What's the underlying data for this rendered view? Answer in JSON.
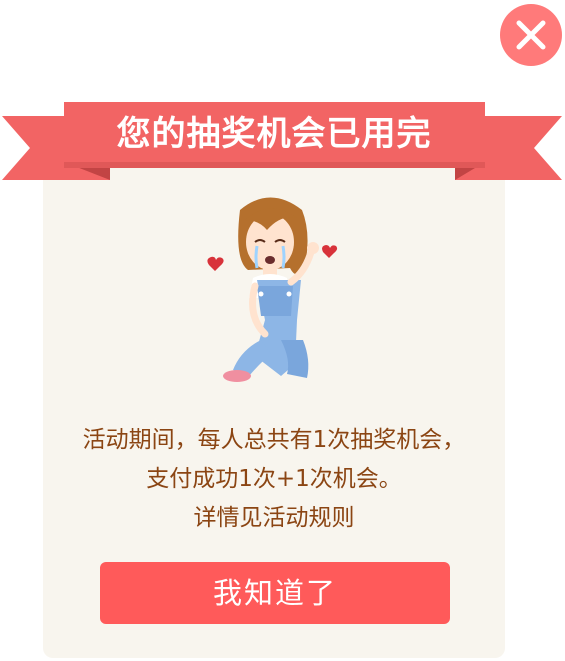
{
  "dialog": {
    "title": "您的抽奖机会已用完",
    "message_line1": "活动期间，每人总共有1次抽奖机会，",
    "message_line2": "支付成功1次+1次机会。",
    "message_line3": "详情见活动规则",
    "confirm_label": "我知道了",
    "close_icon": "close-icon",
    "illustration": "crying-girl-illustration"
  },
  "colors": {
    "accent": "#ff5a5a",
    "ribbon": "#f26464",
    "ribbon_dark": "#d94c4c",
    "close": "#ff7a7a",
    "card_bg": "#f8f5ee",
    "text": "#8b4513"
  }
}
